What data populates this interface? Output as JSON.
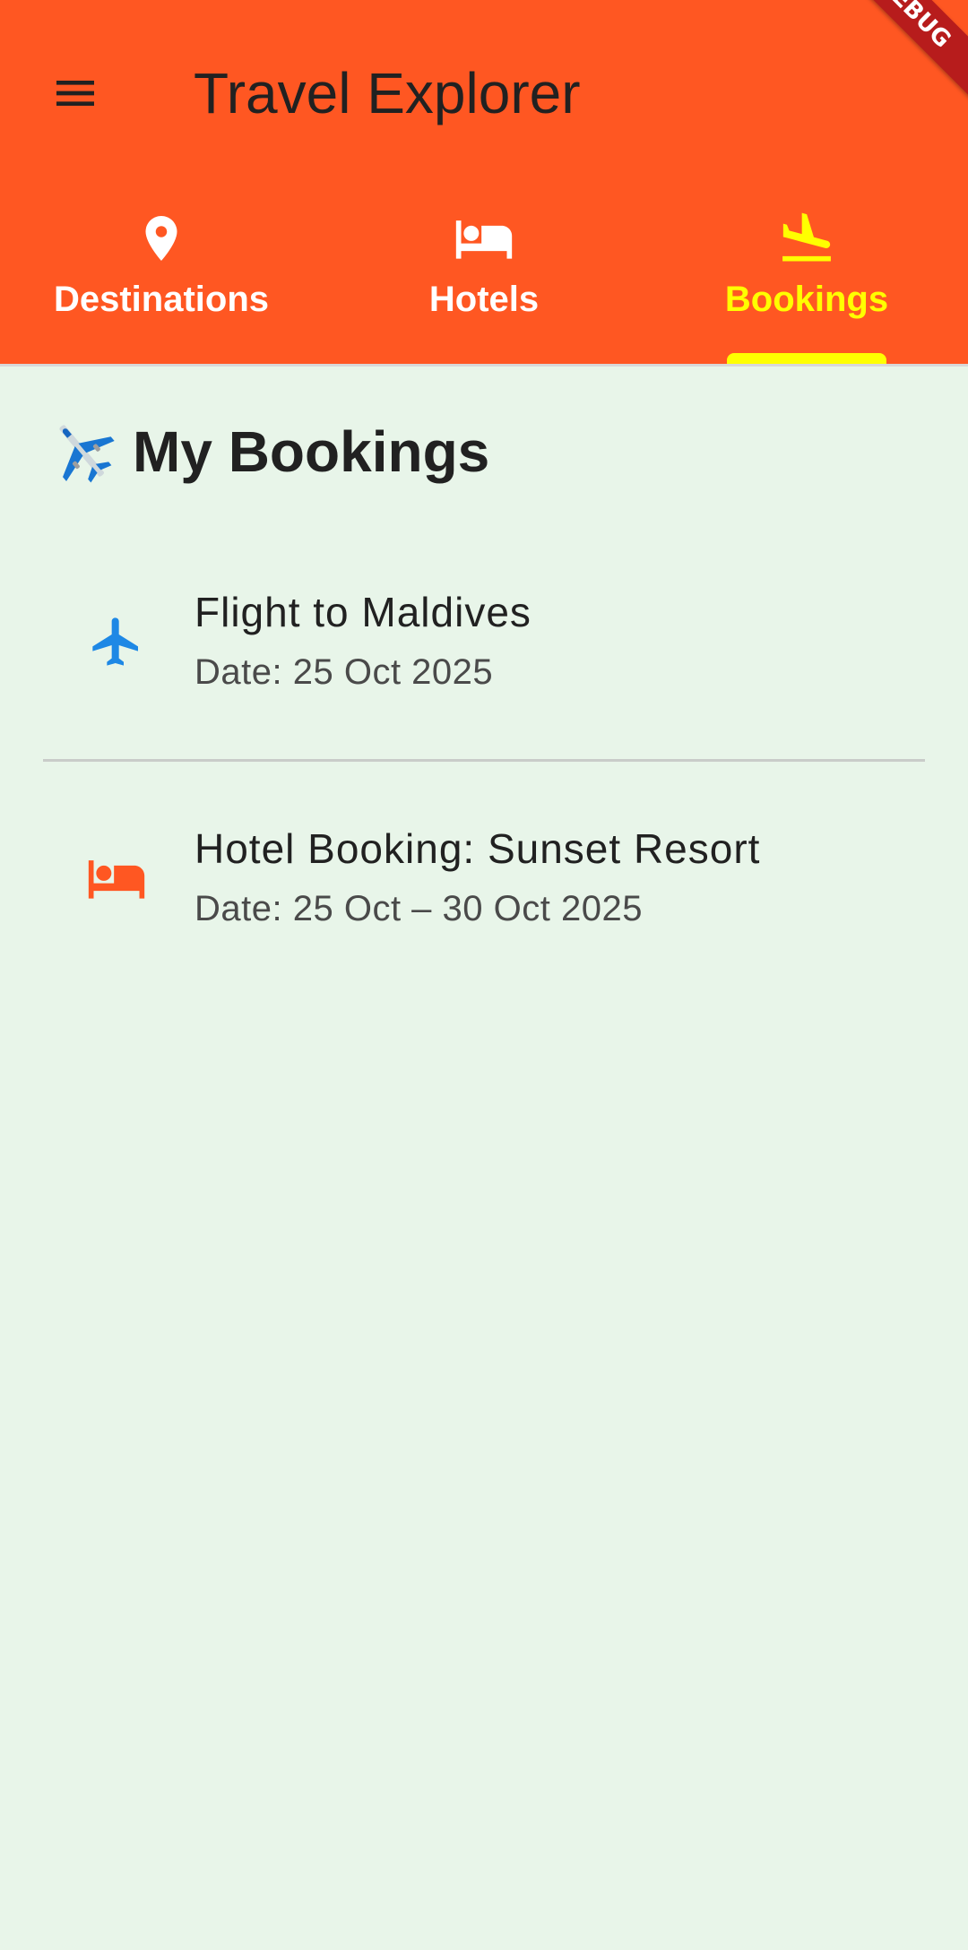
{
  "app_bar": {
    "title": "Travel Explorer",
    "menu_icon": "menu-icon",
    "background_color": "#FF5722",
    "debug_banner": "DEBUG"
  },
  "tabs": [
    {
      "label": "Destinations",
      "icon": "location-pin-icon",
      "active": false
    },
    {
      "label": "Hotels",
      "icon": "bed-icon",
      "active": false
    },
    {
      "label": "Bookings",
      "icon": "flight-land-icon",
      "active": true
    }
  ],
  "colors": {
    "tab_active": "#FFFF00",
    "tab_inactive": "#FFFFFF",
    "page_background": "#E8F5E9",
    "flight_icon": "#1E88E5",
    "hotel_icon": "#FF5722"
  },
  "main": {
    "heading_icon": "airplane-emoji-icon",
    "heading": "My Bookings",
    "bookings": [
      {
        "title": "Flight to Maldives",
        "date": "Date: 25 Oct 2025",
        "icon": "airplane-icon"
      },
      {
        "title": "Hotel Booking: Sunset Resort",
        "date": "Date: 25 Oct – 30 Oct 2025",
        "icon": "hotel-bed-icon"
      }
    ]
  }
}
